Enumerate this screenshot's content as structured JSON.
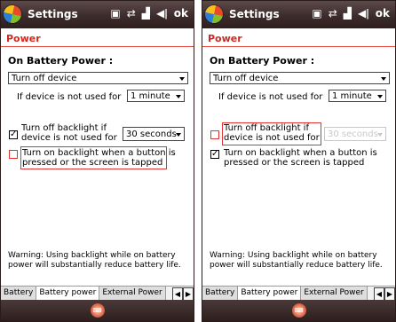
{
  "screens": [
    {
      "title": "Settings",
      "ok": "ok",
      "page": "Power",
      "section": "On Battery Power :",
      "mode_select": "Turn off device",
      "idle_label": "If device is not used for",
      "idle_select": "1 minute",
      "backlight_label_line1": "Turn off backlight if",
      "backlight_label_line2": "device is not used for",
      "backlight_checked": true,
      "backlight_select": "30 seconds",
      "button_label_line1": "Turn on backlight when a button is",
      "button_label_line2": "pressed or the screen is tapped",
      "button_checked": false,
      "warning": "Warning: Using backlight while on battery power will substantially reduce battery life.",
      "tabs": [
        "Battery",
        "Battery power",
        "External Power"
      ],
      "active_tab": "Battery power"
    },
    {
      "title": "Settings",
      "ok": "ok",
      "page": "Power",
      "section": "On Battery Power :",
      "mode_select": "Turn off device",
      "idle_label": "If device is not used for",
      "idle_select": "1 minute",
      "backlight_label_line1": "Turn off backlight if",
      "backlight_label_line2": "device is not used for",
      "backlight_checked": false,
      "backlight_select": "30 seconds",
      "button_label_line1": "Turn on backlight when a button is",
      "button_label_line2": "pressed or the screen is tapped",
      "button_checked": true,
      "warning": "Warning: Using backlight while on battery power will substantially reduce battery life.",
      "tabs": [
        "Battery",
        "Battery power",
        "External Power"
      ],
      "active_tab": "Battery power"
    }
  ],
  "icons": {
    "start": "windows-start-icon",
    "tray": [
      "connectivity-icon",
      "network-icon",
      "signal-icon",
      "volume-icon"
    ],
    "tab_left": "chevron-left-icon",
    "tab_right": "chevron-right-icon",
    "keyboard": "input-panel-icon"
  },
  "colors": {
    "accent": "#d1271f",
    "highlight": "#dd3333",
    "titlebar": "#3c2c2b"
  }
}
